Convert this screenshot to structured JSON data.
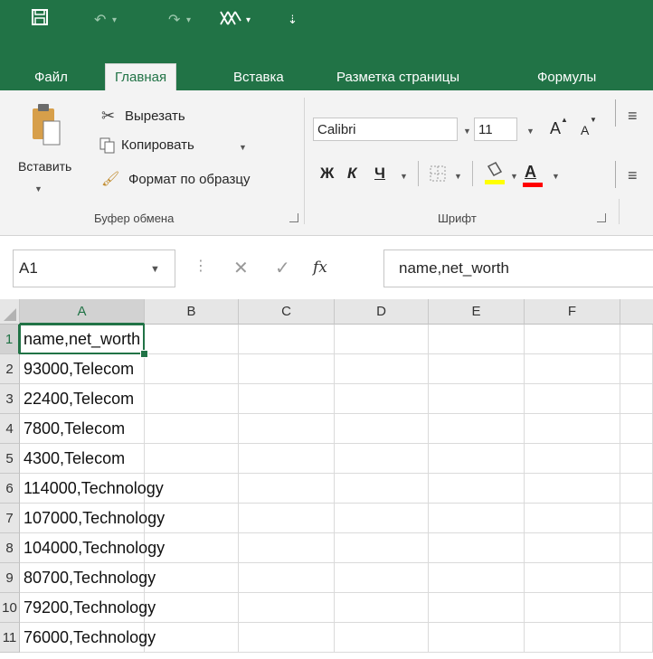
{
  "quick_access": {
    "save_icon": "save-icon",
    "undo_icon": "undo-icon",
    "redo_icon": "redo-icon",
    "custom_icon": "custom-icon",
    "more_icon": "customize-qat-icon"
  },
  "tabs": [
    {
      "label": "Файл",
      "active": false
    },
    {
      "label": "Главная",
      "active": true
    },
    {
      "label": "Вставка",
      "active": false
    },
    {
      "label": "Разметка страницы",
      "active": false
    },
    {
      "label": "Формулы",
      "active": false
    }
  ],
  "ribbon": {
    "clipboard": {
      "paste_label": "Вставить",
      "cut_label": "Вырезать",
      "copy_label": "Копировать",
      "format_painter_label": "Формат по образцу",
      "group_label": "Буфер обмена"
    },
    "font": {
      "font_name": "Calibri",
      "font_size": "11",
      "bold_label": "Ж",
      "italic_label": "К",
      "underline_label": "Ч",
      "grow_label": "A",
      "shrink_label": "A",
      "font_color_label": "A",
      "group_label": "Шрифт",
      "highlight_color": "#ffff00",
      "font_color": "#ff0000"
    }
  },
  "formula_bar": {
    "name_box": "A1",
    "fx_label": "fx",
    "content": "name,net_worth"
  },
  "sheet": {
    "columns": [
      "A",
      "B",
      "C",
      "D",
      "E",
      "F"
    ],
    "active_column": "A",
    "active_row": 1,
    "rows": [
      {
        "num": "1",
        "a": "name,net_worth"
      },
      {
        "num": "2",
        "a": "93000,Telecom"
      },
      {
        "num": "3",
        "a": "22400,Telecom"
      },
      {
        "num": "4",
        "a": "7800,Telecom"
      },
      {
        "num": "5",
        "a": "4300,Telecom"
      },
      {
        "num": "6",
        "a": "114000,Technology"
      },
      {
        "num": "7",
        "a": "107000,Technology"
      },
      {
        "num": "8",
        "a": "104000,Technology"
      },
      {
        "num": "9",
        "a": "80700,Technology"
      },
      {
        "num": "10",
        "a": "79200,Technology"
      },
      {
        "num": "11",
        "a": "76000,Technology"
      }
    ]
  },
  "colors": {
    "brand": "#217346",
    "ribbon_bg": "#f3f3f3",
    "grid_line": "#dadada"
  }
}
